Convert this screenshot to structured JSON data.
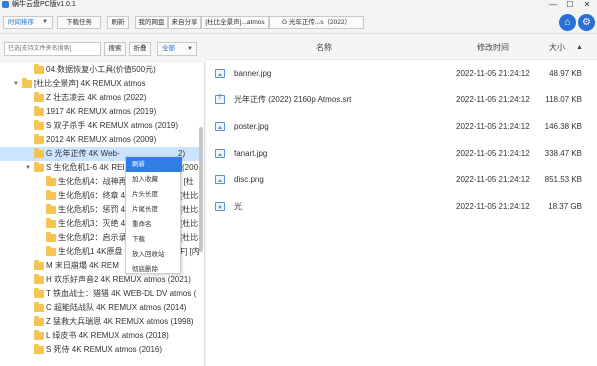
{
  "window": {
    "title": "蜗牛云盘PC版v1.0.1",
    "minimize": "—",
    "maximize": "☐",
    "close": "✕"
  },
  "toolbar": {
    "sort_select": "时间排序",
    "download_tasks": "下载任务",
    "refresh": "刷新",
    "breadcrumbs": [
      "我的网盘",
      "来自分享",
      "[杜比全景声]...atmos",
      "G 光年正传...s（2022）"
    ]
  },
  "sidebar": {
    "search_placeholder": "已选[支持文件夹名搜索]",
    "search_button": "搜索",
    "collapse_button": "折叠",
    "filter_select": "全部",
    "tree": [
      {
        "label": "04.数据恢复小工具(价值500元)",
        "level": 3,
        "expanded": false
      },
      {
        "label": "[杜比全景声] 4K REMUX atmos",
        "level": 2,
        "expanded": true
      },
      {
        "label": "Z 壮志凌云 4K atmos (2022)",
        "level": 3,
        "expanded": false
      },
      {
        "label": "1917 4K REMUX atmos (2019)",
        "level": 3,
        "expanded": false
      },
      {
        "label": "S 双子杀手 4K REMUX atmos (2019)",
        "level": 3,
        "expanded": false
      },
      {
        "label": "2012 4K REMUX atmos  (2009)",
        "level": 3,
        "expanded": false
      },
      {
        "label": "G 光年正传 4K Web-",
        "level": 3,
        "expanded": false,
        "selected": true
      },
      {
        "label": "S 生化危机1-6 4K REI",
        "level": 3,
        "expanded": true
      },
      {
        "label": "生化危机4：战神再",
        "level": 4
      },
      {
        "label": "生化危机6：终章 4",
        "level": 4
      },
      {
        "label": "生化危机5：惩罚 4",
        "level": 4
      },
      {
        "label": "生化危机3：灭绝 4",
        "level": 4
      },
      {
        "label": "生化危机2：启示录",
        "level": 4
      },
      {
        "label": "生化危机1 4K原盘",
        "level": 4
      },
      {
        "label": "M 末日崩塌 4K REM",
        "level": 3
      },
      {
        "label": "H 欢乐好声音2 4K REMUX atmos (2021)",
        "level": 3
      },
      {
        "label": "T 铁血战士：猎猎 4K WEB-DL DV atmos (",
        "level": 3
      },
      {
        "label": "C 超能陆战队 4K REMUX atmos (2014)",
        "level": 3
      },
      {
        "label": "Z 猛救大兵瑞恩 4K REMUX atmos  (1998)",
        "level": 3
      },
      {
        "label": "L 绿皮书 4K REMUX atmos  (2018)",
        "level": 3
      },
      {
        "label": "S 死侍 4K REMUX atmos (2016)",
        "level": 3
      }
    ],
    "tree_suffixes": {
      "selected": "2)",
      "s_series": "(200",
      "row8": "X [杜",
      "row9": "[杜比",
      "row10": "[杜比",
      "row11": "[杜比",
      "row12": "[杜比",
      "row13": "[F]  [内"
    }
  },
  "context_menu": {
    "items": [
      "刷新",
      "加入收藏",
      "片头长度",
      "片尾长度",
      "重命名",
      "下载",
      "放入回收站",
      "彻底删除"
    ]
  },
  "files": {
    "columns": {
      "name": "名称",
      "modified": "修改时间",
      "size": "大小",
      "sort_indicator": "▲"
    },
    "rows": [
      {
        "name": "banner.jpg",
        "modified": "2022-11-05 21:24:12",
        "size": "48.97 KB",
        "icon": "image-file-icon"
      },
      {
        "name": "光年正传 (2022) 2160p Atmos.srt",
        "modified": "2022-11-05 21:24:12",
        "size": "118.07 KB",
        "icon": "subtitle-file-icon"
      },
      {
        "name": "poster.jpg",
        "modified": "2022-11-05 21:24:12",
        "size": "146.38 KB",
        "icon": "image-file-icon"
      },
      {
        "name": "fanart.jpg",
        "modified": "2022-11-05 21:24:12",
        "size": "338.47 KB",
        "icon": "image-file-icon"
      },
      {
        "name": "disc.png",
        "modified": "2022-11-05 21:24:12",
        "size": "851.53 KB",
        "icon": "image-file-icon"
      },
      {
        "name": "光",
        "modified": "2022-11-05 21:24:12",
        "size": "18.37 GB",
        "icon": "video-file-icon"
      }
    ]
  },
  "colors": {
    "accent": "#2f7ee8",
    "selected_row": "#cce4ff",
    "folder": "#f5c451"
  }
}
